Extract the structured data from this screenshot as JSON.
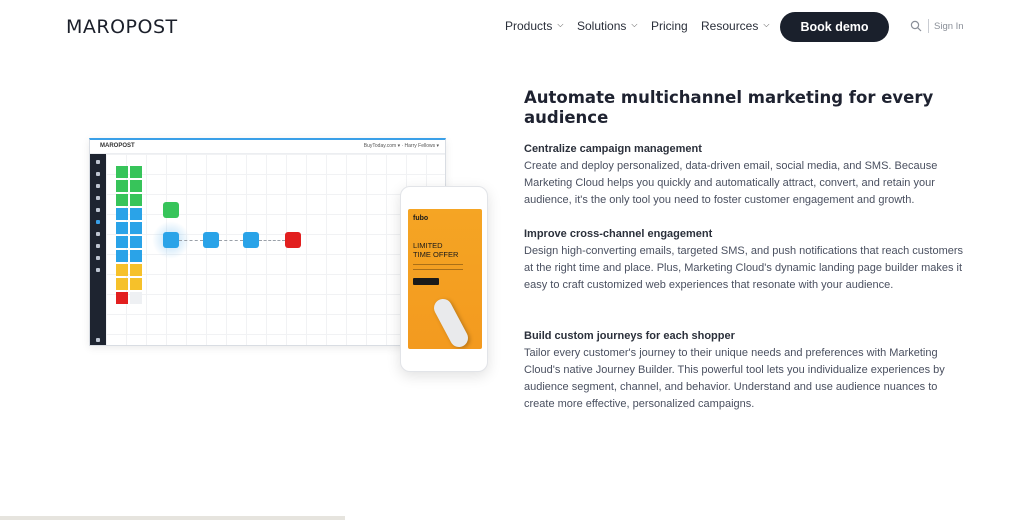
{
  "header": {
    "logo": "MAROPOST",
    "nav": [
      "Products",
      "Solutions",
      "Pricing",
      "Resources"
    ],
    "book_demo": "Book demo",
    "sign_in": "Sign In"
  },
  "illustration": {
    "dashboard_logo": "MAROPOST",
    "dashboard_account": "BuyToday.com ▾  ·  Harry Fellows ▾",
    "phone": {
      "brand": "fubo",
      "offer_line1": "LIMITED",
      "offer_line2": "TIME OFFER"
    },
    "colors": {
      "green": "#37c45a",
      "blue": "#2aa3e8",
      "yellow": "#f6c12a",
      "red": "#e21f1f",
      "orange": "#f5a524"
    }
  },
  "content": {
    "headline": "Automate multichannel marketing for every audience",
    "features": [
      {
        "title": "Centralize campaign management",
        "body": "Create and deploy personalized, data-driven email, social media, and SMS. Because Marketing Cloud helps you quickly and automatically attract, convert, and retain your audience, it's the only tool you need to foster customer engagement and growth."
      },
      {
        "title": "Improve cross-channel engagement",
        "body": "Design high-converting emails, targeted SMS, and push notifications that reach customers at the right time and place. Plus, Marketing Cloud's dynamic landing page builder makes it easy to craft customized web experiences that resonate with your audience."
      },
      {
        "title": "Build custom journeys for each shopper",
        "body": "Tailor every customer's journey to their unique needs and preferences with Marketing Cloud's native Journey Builder. This powerful tool lets you individualize experiences by audience segment, channel, and behavior. Understand and use audience nuances to create more effective, personalized campaigns."
      }
    ]
  }
}
